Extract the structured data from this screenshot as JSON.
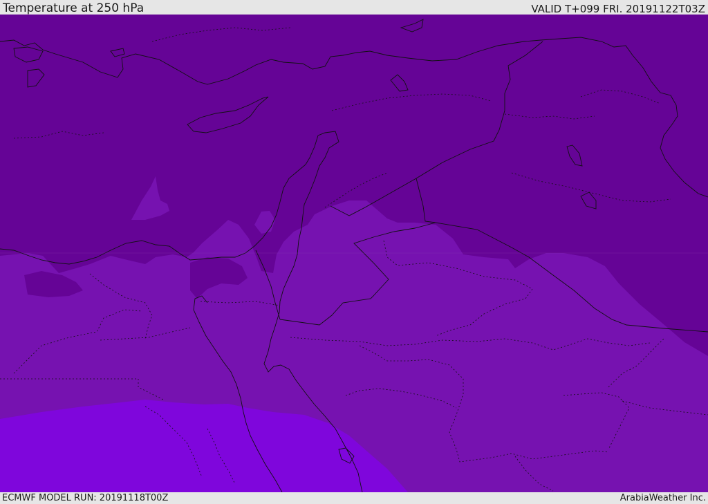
{
  "header": {
    "title": "Temperature at 250 hPa",
    "valid_time": "VALID T+099 FRI. 20191122T03Z"
  },
  "footer": {
    "model_run": "ECMWF MODEL RUN: 20191118T00Z",
    "credit": "ArabiaWeather Inc."
  },
  "map": {
    "field": "temperature",
    "level": "250 hPa",
    "colors": {
      "coldest_band": "#650496",
      "mid_band": "#7612b0",
      "warmest_band": "#7f06dc",
      "coastline": "#111111",
      "border": "#111111"
    }
  }
}
